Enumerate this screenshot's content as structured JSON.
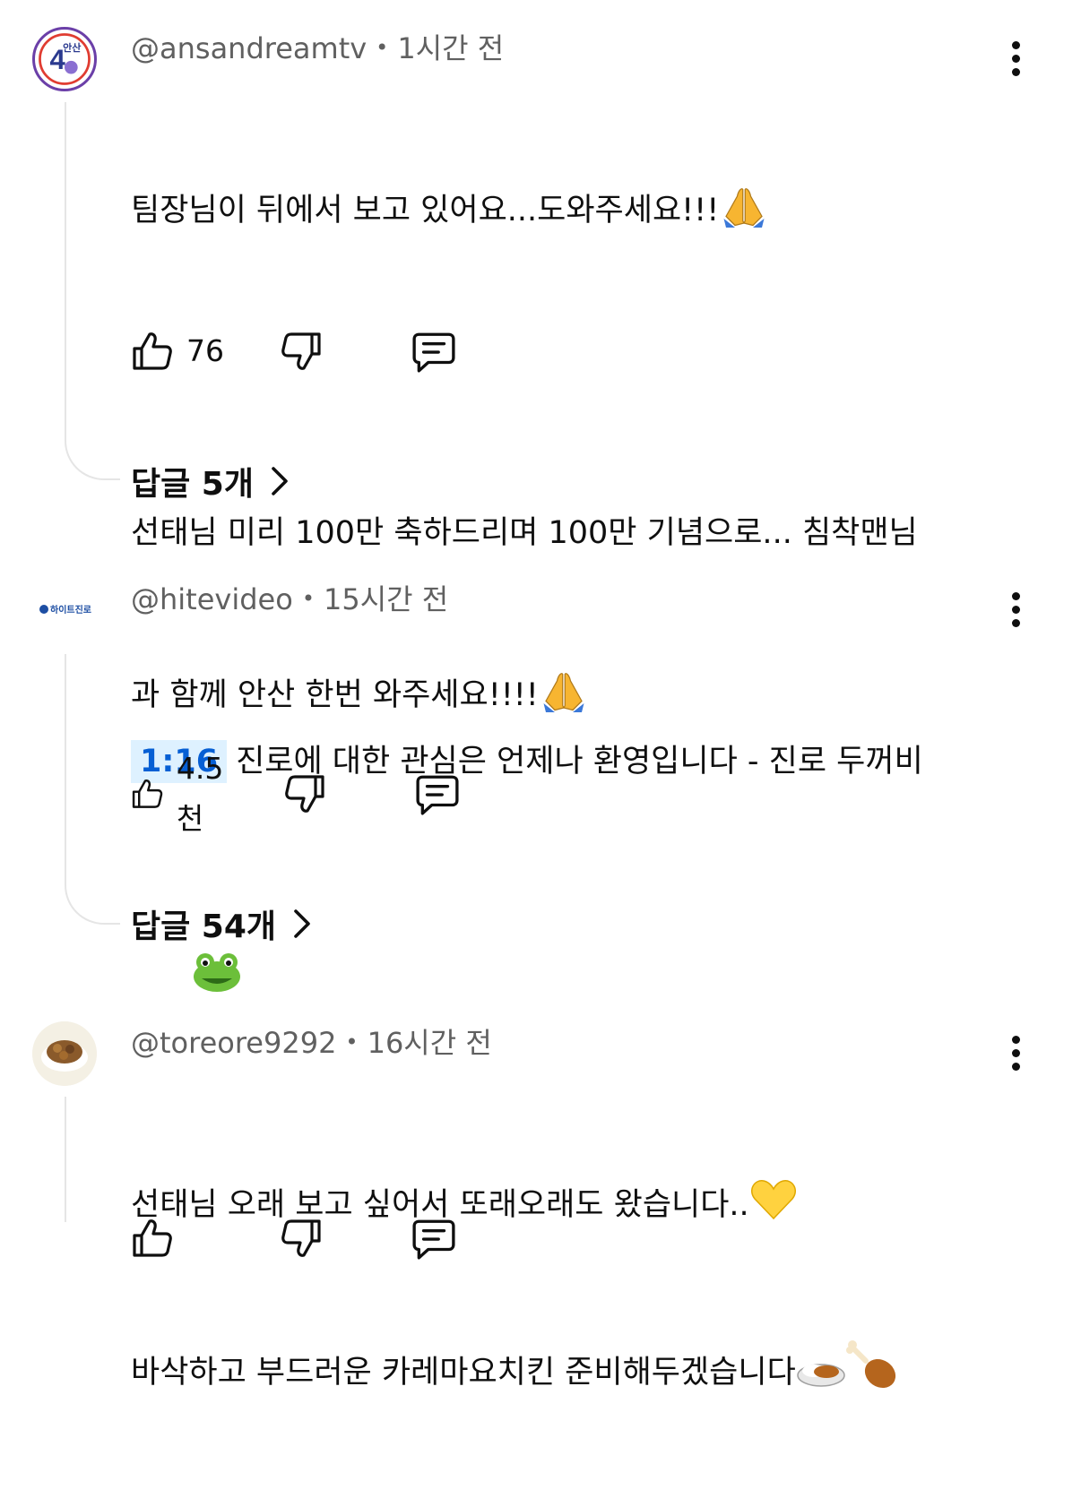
{
  "comments": [
    {
      "author": "@ansandreamtv",
      "time": "1시간 전",
      "avatar_text": "안산",
      "avatar_big": "4",
      "lines": [
        "팀장님이 뒤에서 보고 있어요...도와주세요!!!",
        "",
        "선태님 미리 100만 축하드리며 100만 기념으로... 침착맨님",
        "과 함께 안산 한번 와주세요!!!!"
      ],
      "likes": "76",
      "replies": "답글 5개"
    },
    {
      "author": "@hitevideo",
      "time": "15시간 전",
      "avatar_text": "하이트진로",
      "timestamp": "1:16",
      "line1": "진로에 대한 관심은 언제나 환영입니다 - 진로 두꺼비",
      "likes": "4.5천",
      "replies": "답글 54개"
    },
    {
      "author": "@toreore9292",
      "time": "16시간 전",
      "lines": [
        "선태님 오래 보고 싶어서 또래오래도 왔습니다..",
        "바삭하고 부드러운 카레마요치킨 준비해두겠습니다"
      ]
    }
  ],
  "icons": {
    "like": "thumb-up-icon",
    "dislike": "thumb-down-icon",
    "reply": "comment-icon",
    "more": "more-vert-icon",
    "chevron": "chevron-right-icon",
    "emoji_pray": "folded-hands-emoji",
    "emoji_frog": "frog-emoji",
    "emoji_heart": "yellow-heart-emoji",
    "emoji_curry": "curry-rice-emoji",
    "emoji_drumstick": "poultry-leg-emoji"
  },
  "colors": {
    "text": "#0f0f0f",
    "meta": "#606060",
    "timestamp_bg": "#def1ff",
    "timestamp_fg": "#065fd4"
  }
}
